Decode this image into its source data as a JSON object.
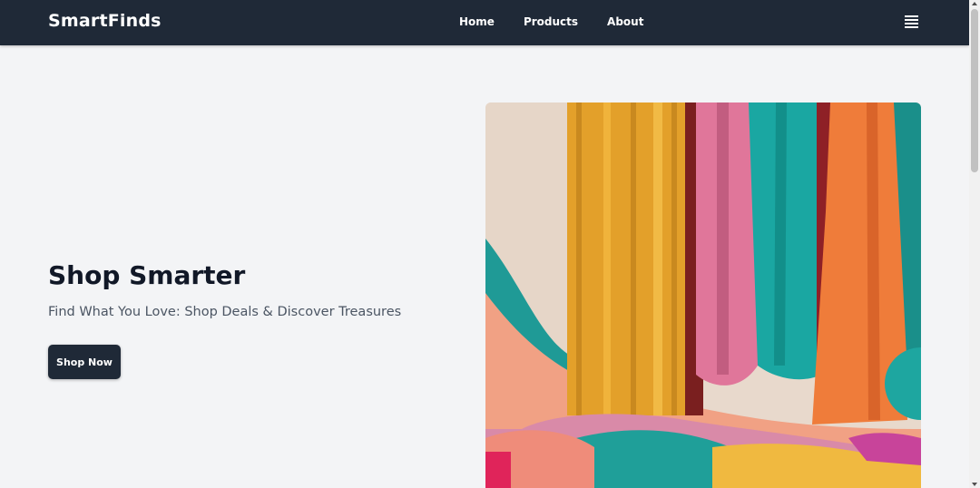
{
  "navbar": {
    "brand": "SmartFinds",
    "links": [
      "Home",
      "Products",
      "About"
    ],
    "menu_icon": "hamburger-menu-icon"
  },
  "hero": {
    "title": "Shop Smarter",
    "subtitle": "Find What You Love: Shop Deals & Discover Treasures",
    "cta_label": "Shop Now",
    "image": "colorful-fabric-drapes-image"
  },
  "colors": {
    "navbar_bg": "#1f2937",
    "page_bg": "#f3f4f6",
    "button_bg": "#1f2937",
    "title_text": "#111827",
    "subtitle_text": "#4b5563"
  }
}
